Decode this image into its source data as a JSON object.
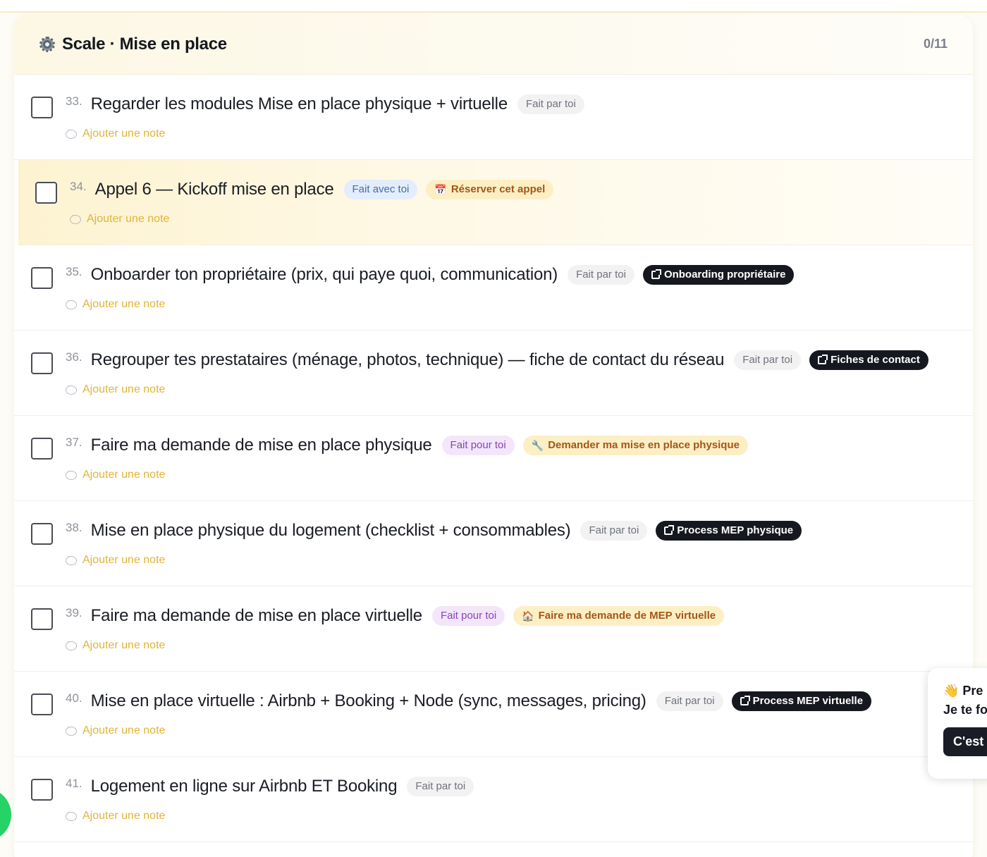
{
  "header": {
    "title": "Scale · Mise en place",
    "progress": "0/11",
    "icon": "gear-icon"
  },
  "colors": {
    "accent_yellow": "#e0b43a",
    "dark_button": "#15181f",
    "highlight_bg": "#fdf3d1"
  },
  "tasks": [
    {
      "num": "33.",
      "title": "Regarder les modules Mise en place physique + virtuelle",
      "tag": "Fait par toi",
      "tag_type": "par",
      "action": "",
      "action_type": "",
      "note": "Ajouter une note"
    },
    {
      "num": "34.",
      "title": "Appel 6 — Kickoff mise en place",
      "tag": "Fait avec toi",
      "tag_type": "avec",
      "action": "Réserver cet appel",
      "action_type": "yel",
      "action_emoji": "📅",
      "note": "Ajouter une note",
      "highlight": true
    },
    {
      "num": "35.",
      "title": "Onboarder ton propriétaire (prix, qui paye quoi, communication)",
      "tag": "Fait par toi",
      "tag_type": "par",
      "action": "Onboarding propriétaire",
      "action_type": "dark",
      "note": "Ajouter une note"
    },
    {
      "num": "36.",
      "title": "Regrouper tes prestataires (ménage, photos, technique) — fiche de contact du réseau",
      "tag": "Fait par toi",
      "tag_type": "par",
      "action": "Fiches de contact",
      "action_type": "dark",
      "note": "Ajouter une note"
    },
    {
      "num": "37.",
      "title": "Faire ma demande de mise en place physique",
      "tag": "Fait pour toi",
      "tag_type": "pour",
      "action": "Demander ma mise en place physique",
      "action_type": "yel",
      "action_emoji": "🔧",
      "note": "Ajouter une note"
    },
    {
      "num": "38.",
      "title": "Mise en place physique du logement (checklist + consommables)",
      "tag": "Fait par toi",
      "tag_type": "par",
      "action": "Process MEP physique",
      "action_type": "dark",
      "note": "Ajouter une note"
    },
    {
      "num": "39.",
      "title": "Faire ma demande de mise en place virtuelle",
      "tag": "Fait pour toi",
      "tag_type": "pour",
      "action": "Faire ma demande de MEP virtuelle",
      "action_type": "yel",
      "action_emoji": "🏠",
      "note": "Ajouter une note"
    },
    {
      "num": "40.",
      "title": "Mise en place virtuelle : Airbnb + Booking + Node (sync, messages, pricing)",
      "tag": "Fait par toi",
      "tag_type": "par",
      "action": "Process MEP virtuelle",
      "action_type": "dark",
      "note": "Ajouter une note"
    },
    {
      "num": "41.",
      "title": "Logement en ligne sur Airbnb ET Booking",
      "tag": "Fait par toi",
      "tag_type": "par",
      "action": "",
      "action_type": "",
      "note": "Ajouter une note"
    }
  ],
  "popup": {
    "line1": "👋 Pre",
    "line2": "Je te fo",
    "button": "C'est"
  }
}
